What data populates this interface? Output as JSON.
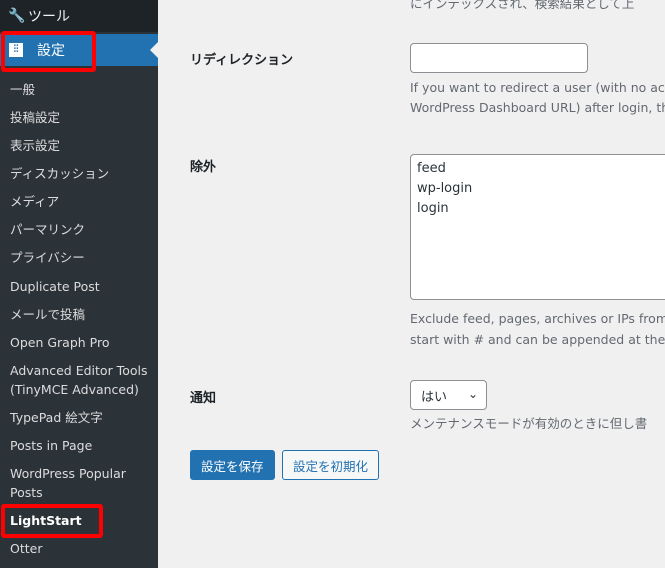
{
  "sidebar": {
    "tools_label": "ツール",
    "settings_label": "設定",
    "items": [
      "一般",
      "投稿設定",
      "表示設定",
      "ディスカッション",
      "メディア",
      "パーマリンク",
      "プライバシー",
      "Duplicate Post",
      "メールで投稿",
      "Open Graph Pro",
      "Advanced Editor Tools (TinyMCE Advanced)",
      "TypePad 絵文字",
      "Posts in Page",
      "WordPress Popular Posts",
      "LightStart",
      "Otter"
    ]
  },
  "main": {
    "top_text": "にインデックスされ、検索結果として上",
    "redirect": {
      "label": "リディレクション",
      "value": "",
      "desc1": "If you want to redirect a user (with no acc",
      "desc2": "WordPress Dashboard URL) after login, th"
    },
    "exclude": {
      "label": "除外",
      "lines": [
        "feed",
        "wp-login",
        "login"
      ],
      "desc1": "Exclude feed, pages, archives or IPs from",
      "desc2": "start with # and can be appended at the e"
    },
    "notify": {
      "label": "通知",
      "selected": "はい",
      "desc": "メンテナンスモードが有効のときに但し書"
    },
    "save_label": "設定を保存",
    "reset_label": "設定を初期化"
  },
  "colors": {
    "accent": "#2271b1",
    "highlight": "#ff0000",
    "sidebar": "#2c3338"
  }
}
